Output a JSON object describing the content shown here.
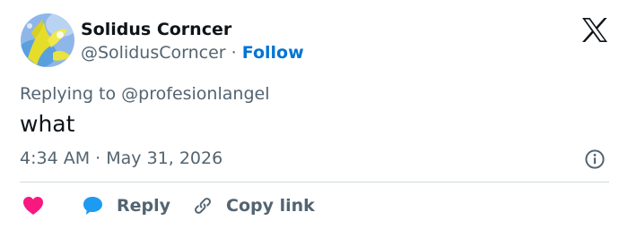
{
  "author": {
    "display_name": "Solidus Corncer",
    "handle": "@SolidusCorncer",
    "separator": "·",
    "follow_label": "Follow",
    "avatar_icon": "avatar-image"
  },
  "brand": {
    "logo_icon": "x-logo-icon"
  },
  "tweet": {
    "replying_prefix": "Replying to",
    "replying_to": "@profesionlangel",
    "text": "what",
    "time": "4:34 AM",
    "date_separator": "·",
    "date": "May 31, 2026"
  },
  "actions": {
    "like_icon": "heart-icon",
    "reply_icon": "speech-bubble-icon",
    "reply_label": "Reply",
    "copy_icon": "link-icon",
    "copy_label": "Copy link",
    "info_icon": "info-icon"
  },
  "colors": {
    "accent": "#0074d4",
    "like": "#f91880",
    "reply_bubble": "#1d9bf0",
    "secondary_text": "#536471",
    "divider": "#cfd9de"
  }
}
